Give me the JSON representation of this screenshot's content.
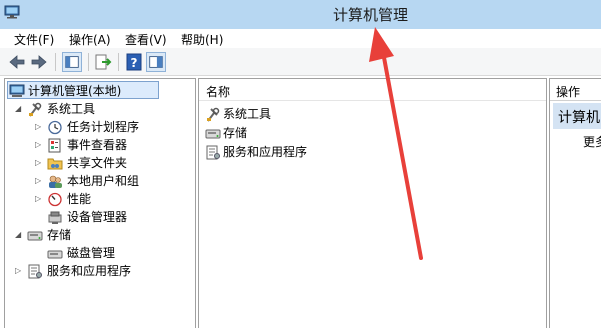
{
  "window": {
    "title": "计算机管理"
  },
  "menu": [
    {
      "label": "文件(F)"
    },
    {
      "label": "操作(A)"
    },
    {
      "label": "查看(V)"
    },
    {
      "label": "帮助(H)"
    }
  ],
  "tree": {
    "root": "计算机管理(本地)",
    "system_tools": "系统工具",
    "task_scheduler": "任务计划程序",
    "event_viewer": "事件查看器",
    "shared_folders": "共享文件夹",
    "local_users": "本地用户和组",
    "performance": "性能",
    "device_manager": "设备管理器",
    "storage": "存储",
    "disk_management": "磁盘管理",
    "services_apps": "服务和应用程序"
  },
  "main": {
    "column_name": "名称",
    "items": [
      {
        "label": "系统工具"
      },
      {
        "label": "存储"
      },
      {
        "label": "服务和应用程序"
      }
    ]
  },
  "actions": {
    "header": "操作",
    "selected": "计算机",
    "more": "更多"
  },
  "colors": {
    "titlebar": "#b7d7f2",
    "arrow": "#e8403a",
    "selection": "#dcebfc"
  }
}
